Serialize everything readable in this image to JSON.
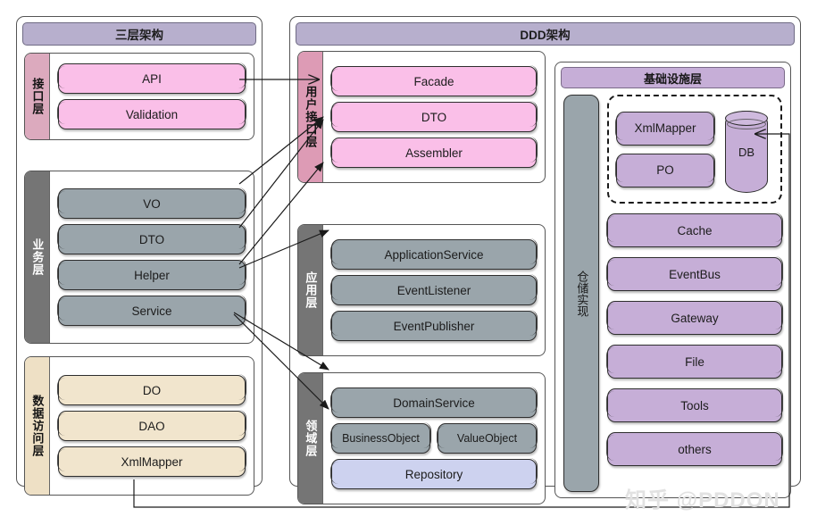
{
  "left_panel": {
    "title": "三层架构",
    "layers": [
      {
        "name": "接口层",
        "items": [
          "API",
          "Validation"
        ]
      },
      {
        "name": "业务层",
        "items": [
          "VO",
          "DTO",
          "Helper",
          "Service"
        ]
      },
      {
        "name": "数据访问层",
        "items": [
          "DO",
          "DAO",
          "XmlMapper"
        ]
      }
    ]
  },
  "ddd_panel": {
    "title": "DDD架构",
    "layers": [
      {
        "name": "用户接口层",
        "items": [
          "Facade",
          "DTO",
          "Assembler"
        ]
      },
      {
        "name": "应用层",
        "items": [
          "ApplicationService",
          "EventListener",
          "EventPublisher"
        ]
      },
      {
        "name": "领域层",
        "items": [
          "DomainService",
          "BusinessObject",
          "ValueObject",
          "Repository"
        ]
      }
    ],
    "infrastructure": {
      "title": "基础设施层",
      "repository_impl_label": "仓储实现",
      "persistence_group": [
        "XmlMapper",
        "PO"
      ],
      "database_label": "DB",
      "items": [
        "Cache",
        "EventBus",
        "Gateway",
        "File",
        "Tools",
        "others"
      ]
    }
  },
  "watermark": "知乎 @PDDON",
  "colors": {
    "pink": "#fabfe8",
    "gray": "#9aa5ab",
    "beige": "#f1e5cd",
    "purple": "#c6aed7",
    "lavender": "#cdd2ef",
    "title_bar": "#b7afcd",
    "side_interface": "#dcaabe",
    "side_business": "#757575",
    "side_data": "#eee0c5",
    "side_ui": "#dd9bb5"
  }
}
